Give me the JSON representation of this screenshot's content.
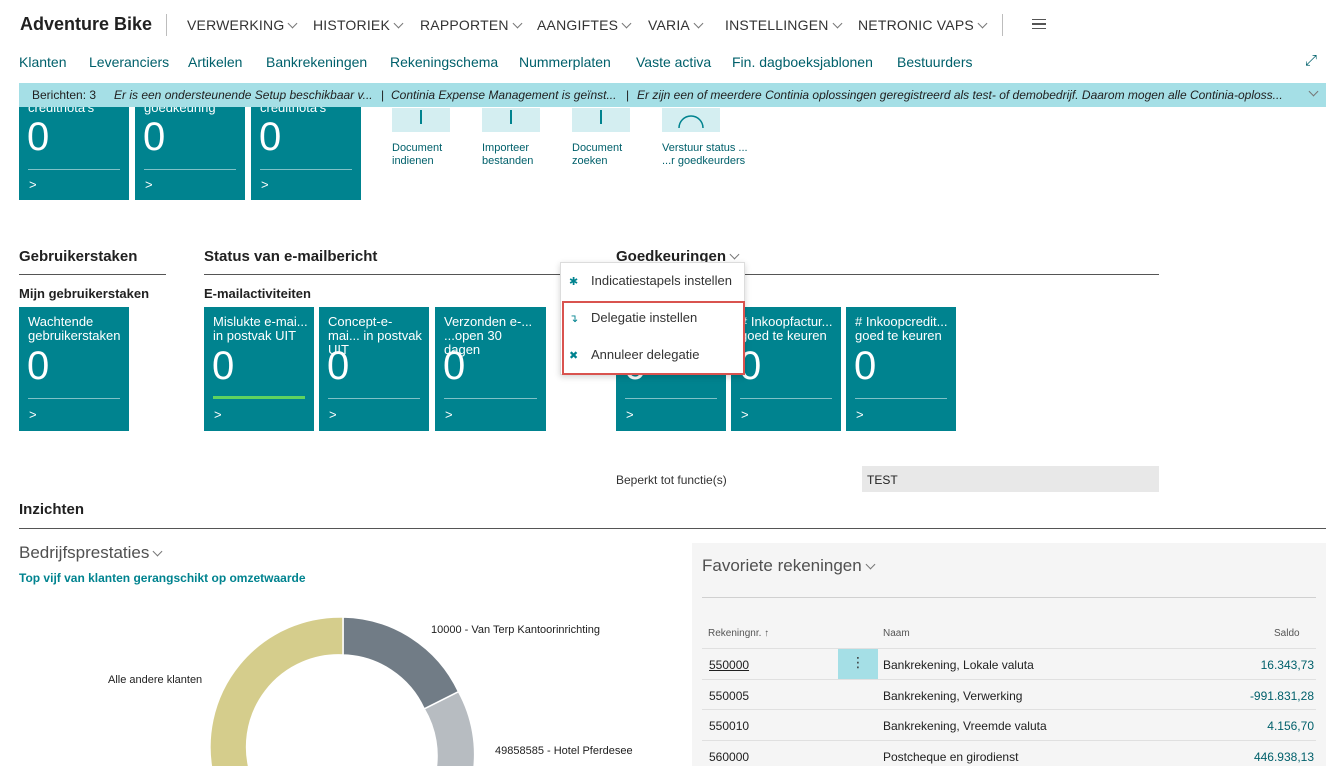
{
  "app": {
    "company": "Adventure Bike",
    "menu": [
      "VERWERKING",
      "HISTORIEK",
      "RAPPORTEN",
      "AANGIFTES",
      "VARIA",
      "INSTELLINGEN",
      "NETRONIC VAPS"
    ],
    "navlinks": [
      "Klanten",
      "Leveranciers",
      "Artikelen",
      "Bankrekeningen",
      "Rekeningschema",
      "Nummerplaten",
      "Vaste activa",
      "Fin. dagboeksjablonen",
      "Bestuurders"
    ]
  },
  "notifications": {
    "count_label": "Berichten: 3",
    "messages": [
      "Er is een ondersteunende Setup beschikbaar v...",
      "Continia Expense Management is geïnst...",
      "Er zijn een of meerdere Continia oplossingen geregistreerd als test- of demobedrijf. Daarom mogen alle Continia-oploss..."
    ]
  },
  "top_tiles": [
    {
      "label": "creditnota's",
      "value": "0"
    },
    {
      "label": "goedkeuring",
      "value": "0"
    },
    {
      "label": "creditnota's",
      "value": "0"
    }
  ],
  "actions": [
    {
      "label1": "Document",
      "label2": "indienen"
    },
    {
      "label1": "Importeer",
      "label2": "bestanden"
    },
    {
      "label1": "Document",
      "label2": "zoeken"
    },
    {
      "label1": "Verstuur status ...",
      "label2": "...r goedkeurders"
    }
  ],
  "sections": {
    "gebruikerstaken": {
      "title": "Gebruikerstaken",
      "sub": "Mijn gebruikerstaken",
      "tile": {
        "label": "Wachtende gebruikerstaken",
        "value": "0"
      }
    },
    "email": {
      "title": "Status van e-mailbericht",
      "sub": "E-mailactiviteiten",
      "tiles": [
        {
          "label": "Mislukte e-mai... in postvak UIT",
          "value": "0"
        },
        {
          "label": "Concept-e-mai... in postvak UIT",
          "value": "0"
        },
        {
          "label": "Verzonden e-... ...open 30 dagen",
          "value": "0"
        }
      ]
    },
    "goedkeuringen": {
      "title": "Goedkeuringen",
      "tiles": [
        {
          "label": "",
          "value": "0"
        },
        {
          "label": "# Inkoopfactur... goed te keuren",
          "value": "0"
        },
        {
          "label": "# Inkoopcredit... goed te keuren",
          "value": "0"
        }
      ],
      "function_label": "Beperkt tot functie(s)",
      "function_value": "TEST"
    }
  },
  "dropdown": {
    "items": [
      {
        "icon": "gears-icon",
        "label": "Indicatiestapels instellen"
      },
      {
        "icon": "delegate-icon",
        "label": "Delegatie instellen"
      },
      {
        "icon": "cancel-delegate-icon",
        "label": "Annuleer delegatie"
      }
    ]
  },
  "insights": {
    "title": "Inzichten",
    "company_perf": {
      "title": "Bedrijfsprestaties",
      "subtitle": "Top vijf van klanten gerangschikt op omzetwaarde",
      "labels": [
        "10000 - Van Terp Kantoorinrichting",
        "Alle andere klanten",
        "49858585 - Hotel Pferdesee"
      ]
    },
    "favorites": {
      "title": "Favoriete rekeningen",
      "headers": {
        "nr": "Rekeningnr. ↑",
        "name": "Naam",
        "saldo": "Saldo"
      },
      "rows": [
        {
          "nr": "550000",
          "name": "Bankrekening, Lokale valuta",
          "saldo": "16.343,73"
        },
        {
          "nr": "550005",
          "name": "Bankrekening, Verwerking",
          "saldo": "-991.831,28"
        },
        {
          "nr": "550010",
          "name": "Bankrekening, Vreemde valuta",
          "saldo": "4.156,70"
        },
        {
          "nr": "560000",
          "name": "Postcheque en girodienst",
          "saldo": "446.938,13"
        }
      ]
    }
  },
  "colors": {
    "teal": "#00838f",
    "accent_link": "#00606b",
    "notif_bg": "#a5dfe6",
    "highlight_red": "#d9534f"
  }
}
